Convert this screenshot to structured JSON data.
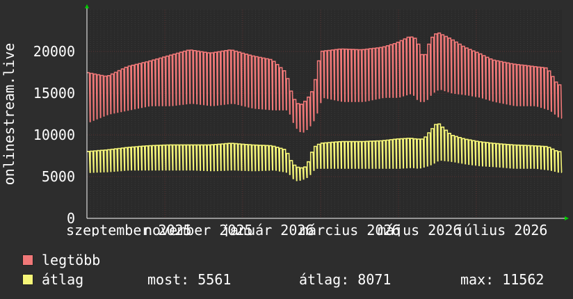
{
  "colors": {
    "background": "#2d2d2d",
    "plot_background": "#2a2a2a",
    "grid_major": "#5a3030",
    "grid_minor": "#3a3a3a",
    "max_series": "#f07878",
    "avg_series": "#f5f578",
    "arrow": "#00cc00"
  },
  "legend": {
    "max_label": "legtöbb",
    "avg_label": "átlag"
  },
  "stats": {
    "most": "most: 5561",
    "atlag": "átlag: 8071",
    "max": "max: 11562"
  },
  "chart_data": {
    "type": "line",
    "ylabel": "onlinestream.live",
    "ylim": [
      0,
      25000
    ],
    "yticks": [
      0,
      5000,
      10000,
      15000,
      20000
    ],
    "xlabels": [
      "szeptember 2025",
      "november 2025",
      "január 2026",
      "március 2026",
      "május 2026",
      "július 2026"
    ],
    "grid": true,
    "series": [
      {
        "name": "legtöbb",
        "envelope": [
          [
            0,
            17500,
            11500
          ],
          [
            6,
            17000,
            12500
          ],
          [
            12,
            18200,
            13000
          ],
          [
            18,
            18800,
            13500
          ],
          [
            24,
            19500,
            13500
          ],
          [
            30,
            20200,
            13800
          ],
          [
            36,
            19800,
            13500
          ],
          [
            42,
            20200,
            13800
          ],
          [
            48,
            19500,
            13200
          ],
          [
            54,
            19000,
            13000
          ],
          [
            58,
            17500,
            13000
          ],
          [
            60,
            14500,
            11000
          ],
          [
            62,
            13500,
            10200
          ],
          [
            64,
            14200,
            10800
          ],
          [
            66,
            15500,
            12000
          ],
          [
            68,
            20000,
            14500
          ],
          [
            74,
            20300,
            14000
          ],
          [
            80,
            20200,
            14000
          ],
          [
            86,
            20500,
            14500
          ],
          [
            90,
            21000,
            14500
          ],
          [
            94,
            21800,
            15000
          ],
          [
            96,
            21500,
            14000
          ],
          [
            98,
            19000,
            14000
          ],
          [
            100,
            21500,
            15000
          ],
          [
            102,
            22300,
            15500
          ],
          [
            106,
            21500,
            15000
          ],
          [
            110,
            20500,
            14800
          ],
          [
            114,
            19800,
            14500
          ],
          [
            118,
            19000,
            14000
          ],
          [
            124,
            18500,
            13500
          ],
          [
            130,
            18200,
            13500
          ],
          [
            134,
            18000,
            13000
          ],
          [
            137,
            16000,
            12000
          ]
        ]
      },
      {
        "name": "átlag",
        "envelope": [
          [
            0,
            8000,
            5500
          ],
          [
            6,
            8200,
            5600
          ],
          [
            12,
            8500,
            5800
          ],
          [
            18,
            8700,
            5800
          ],
          [
            24,
            8800,
            5800
          ],
          [
            30,
            8800,
            5800
          ],
          [
            36,
            8800,
            5700
          ],
          [
            42,
            9000,
            5800
          ],
          [
            48,
            8800,
            5700
          ],
          [
            54,
            8700,
            5800
          ],
          [
            58,
            8200,
            5500
          ],
          [
            60,
            6500,
            4500
          ],
          [
            62,
            6000,
            4600
          ],
          [
            64,
            6200,
            5000
          ],
          [
            66,
            8500,
            6000
          ],
          [
            68,
            9000,
            6000
          ],
          [
            74,
            9200,
            6000
          ],
          [
            80,
            9200,
            6000
          ],
          [
            86,
            9300,
            6000
          ],
          [
            90,
            9500,
            6000
          ],
          [
            94,
            9600,
            6100
          ],
          [
            96,
            9500,
            6000
          ],
          [
            98,
            9500,
            6200
          ],
          [
            100,
            10500,
            6500
          ],
          [
            102,
            11500,
            7000
          ],
          [
            106,
            10000,
            6800
          ],
          [
            110,
            9500,
            6500
          ],
          [
            114,
            9200,
            6300
          ],
          [
            118,
            9000,
            6200
          ],
          [
            124,
            8800,
            6000
          ],
          [
            130,
            8700,
            6000
          ],
          [
            134,
            8600,
            5800
          ],
          [
            137,
            8000,
            5500
          ]
        ]
      }
    ]
  }
}
